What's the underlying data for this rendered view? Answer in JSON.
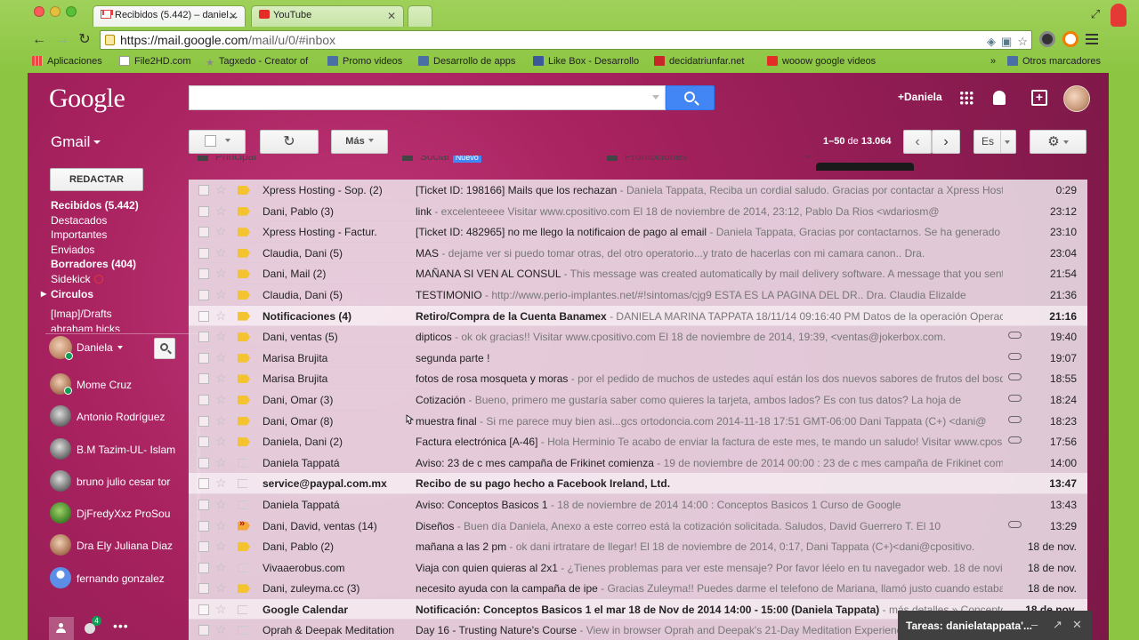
{
  "browser": {
    "tabs": [
      {
        "label": "Recibidos (5.442) – daniel…"
      },
      {
        "label": "YouTube"
      }
    ],
    "url_host": "https://mail.google.com",
    "url_path": "/mail/u/0/#inbox",
    "bookmarks": [
      {
        "label": "Aplicaciones",
        "icon": "apps-icon"
      },
      {
        "label": "File2HD.com",
        "icon": "page-icon"
      },
      {
        "label": "Tagxedo - Creator of",
        "icon": "star-icon"
      },
      {
        "label": "Promo videos",
        "icon": "folder-icon"
      },
      {
        "label": "Desarrollo de apps",
        "icon": "folder-icon"
      },
      {
        "label": "Like Box - Desarrollo",
        "icon": "facebook-icon"
      },
      {
        "label": "decidatriunfar.net",
        "icon": "site-icon"
      },
      {
        "label": "wooow google videos",
        "icon": "youtube-icon"
      },
      {
        "label": "»",
        "icon": ""
      },
      {
        "label": "Otros marcadores",
        "icon": "folder-icon"
      }
    ]
  },
  "gmail": {
    "logo": "Google",
    "search_placeholder": "",
    "account_link": "+Daniela",
    "product_label": "Gmail",
    "more_label": "Más",
    "pager": {
      "range": "1–50",
      "of": "de",
      "total": "13.064"
    },
    "lang": "Es",
    "compose": "REDACTAR",
    "nav": [
      {
        "label": "Recibidos (5.442)",
        "bold": true
      },
      {
        "label": "Destacados",
        "bold": false
      },
      {
        "label": "Importantes",
        "bold": false
      },
      {
        "label": "Enviados",
        "bold": false
      },
      {
        "label": "Borradores (404)",
        "bold": true
      },
      {
        "label": "Sidekick",
        "bold": false
      },
      {
        "label": "Circulos",
        "bold": true
      },
      {
        "label": "[Imap]/Drafts",
        "bold": false
      },
      {
        "label": "abraham hicks",
        "bold": false
      }
    ],
    "chat_user": "Daniela",
    "contacts": [
      {
        "name": "Mome Cruz"
      },
      {
        "name": "Antonio Rodríguez"
      },
      {
        "name": "B.M Tazim-UL- Islam"
      },
      {
        "name": "bruno julio cesar tor"
      },
      {
        "name": "DjFredyXxz ProSou"
      },
      {
        "name": "Dra Ely Juliana Diaz"
      },
      {
        "name": "fernando gonzalez"
      }
    ],
    "hangout_badge": "4",
    "category_tabs": [
      {
        "label": "Principal"
      },
      {
        "label": "Social",
        "badge": "Nuevo"
      },
      {
        "label": "Promociones"
      }
    ],
    "colors": {
      "theme_bg": "#a8225f",
      "accent_blue": "#4285f4",
      "important_yellow": "#f4c430"
    },
    "emails": [
      {
        "sender": "Xpress Hosting - Sop. (2)",
        "subject": "[Ticket ID: 198166] Mails que los rechazan",
        "snippet": " - Daniela Tappata, Reciba un cordial saludo. Gracias por contactar a Xpress Hosting",
        "date": "0:29",
        "unread": false,
        "imp": "on",
        "clip": false
      },
      {
        "sender": "Dani, Pablo (3)",
        "subject": "link",
        "snippet": " - excelenteeee Visitar www.cpositivo.com El 18 de noviembre de 2014, 23:12, Pablo Da Rios <wdariosm@",
        "date": "23:12",
        "unread": false,
        "imp": "on",
        "clip": false
      },
      {
        "sender": "Xpress Hosting - Factur.",
        "subject": "[Ticket ID: 482965] no me llego la notificaion de pago al email",
        "snippet": " - Daniela Tappata, Gracias por contactarnos. Se ha generado el r",
        "date": "23:10",
        "unread": false,
        "imp": "on",
        "clip": false
      },
      {
        "sender": "Claudia, Dani (5)",
        "subject": "MAS",
        "snippet": " - dejame ver si puedo tomar otras, del otro operatorio...y trato de hacerlas con mi camara canon.. Dra.",
        "date": "23:04",
        "unread": false,
        "imp": "on",
        "clip": false
      },
      {
        "sender": "Dani, Mail (2)",
        "subject": "MAÑANA SI VEN AL CONSUL",
        "snippet": " - This message was created automatically by mail delivery software. A message that you sent co",
        "date": "21:54",
        "unread": false,
        "imp": "on",
        "clip": false
      },
      {
        "sender": "Claudia, Dani (5)",
        "subject": "TESTIMONIO",
        "snippet": " - http://www.perio-implantes.net/#!sintomas/cjg9 ESTA ES LA PAGINA DEL DR.. Dra. Claudia Elizalde",
        "date": "21:36",
        "unread": false,
        "imp": "on",
        "clip": false
      },
      {
        "sender": "Notificaciones (4)",
        "subject": "Retiro/Compra de la Cuenta Banamex",
        "snippet": " - DANIELA MARINA TAPPATA 18/11/14 09:16:40 PM Datos de la operación Operació",
        "date": "21:16",
        "unread": true,
        "imp": "on",
        "clip": false
      },
      {
        "sender": "Dani, ventas (5)",
        "subject": "dipticos",
        "snippet": " - ok ok gracias!! Visitar www.cpositivo.com El 18 de noviembre de 2014, 19:39, <ventas@jokerbox.com.",
        "date": "19:40",
        "unread": false,
        "imp": "on",
        "clip": true
      },
      {
        "sender": "Marisa Brujita",
        "subject": "segunda parte !",
        "snippet": "",
        "date": "19:07",
        "unread": false,
        "imp": "on",
        "clip": true
      },
      {
        "sender": "Marisa Brujita",
        "subject": "fotos de rosa mosqueta y moras",
        "snippet": " - por el pedido de muchos de ustedes aquí están los dos nuevos sabores de frutos del bosque,",
        "date": "18:55",
        "unread": false,
        "imp": "on",
        "clip": true
      },
      {
        "sender": "Dani, Omar (3)",
        "subject": "Cotización",
        "snippet": " - Bueno, primero me gustaría saber como quieres la tarjeta, ambos lados? Es con tus datos? La hoja de",
        "date": "18:24",
        "unread": false,
        "imp": "on",
        "clip": true
      },
      {
        "sender": "Dani, Omar (8)",
        "subject": "muestra final",
        "snippet": " - Si me parece muy bien asi...gcs ortodoncia.com 2014-11-18 17:51 GMT-06:00 Dani Tappata (C+) <dani@",
        "date": "18:23",
        "unread": false,
        "imp": "on",
        "clip": true
      },
      {
        "sender": "Daniela, Dani (2)",
        "subject": "Factura electrónica [A-46]",
        "snippet": " - Hola Herminio Te acabo de enviar la factura de este mes, te mando un saludo! Visitar www.cpositivo",
        "date": "17:56",
        "unread": false,
        "imp": "on",
        "clip": true
      },
      {
        "sender": "Daniela Tappatá",
        "subject": "Aviso: 23 de c mes campaña de Frikinet comienza",
        "snippet": " - 19 de noviembre de 2014 00:00 : 23 de c mes campaña de Frikinet comien",
        "date": "14:00",
        "unread": false,
        "imp": "off",
        "clip": false
      },
      {
        "sender": "service@paypal.com.mx",
        "subject": "Recibo de su pago hecho a Facebook Ireland, Ltd.",
        "snippet": "",
        "date": "13:47",
        "unread": true,
        "imp": "off",
        "clip": false
      },
      {
        "sender": "Daniela Tappatá",
        "subject": "Aviso: Conceptos Basicos 1",
        "snippet": " - 18 de noviembre de 2014 14:00 : Conceptos Basicos 1 Curso de Google",
        "date": "13:43",
        "unread": false,
        "imp": "off",
        "clip": false
      },
      {
        "sender": "Dani, David, ventas (14)",
        "subject": "Diseños",
        "snippet": " - Buen día Daniela, Anexo a este correo está la cotización solicitada. Saludos, David Guerrero T. El 10",
        "date": "13:29",
        "unread": false,
        "imp": "fwd",
        "clip": true
      },
      {
        "sender": "Dani, Pablo (2)",
        "subject": "mañana a las 2 pm",
        "snippet": " - ok dani irtratare de llegar! El 18 de noviembre de 2014, 0:17, Dani Tappata (C+)<dani@cpositivo.",
        "date": "18 de nov.",
        "unread": false,
        "imp": "on",
        "clip": false
      },
      {
        "sender": "Vivaaerobus.com",
        "subject": "Viaja con quien quieras al 2x1",
        "snippet": " - ¿Tienes problemas para ver este mensaje? Por favor léelo en tu navegador web. 18 de noviem",
        "date": "18 de nov.",
        "unread": false,
        "imp": "off",
        "clip": false
      },
      {
        "sender": "Dani, zuleyma.cc (3)",
        "subject": "necesito ayuda con la campaña de ipe",
        "snippet": " - Gracias Zuleyma!! Puedes darme el telefono de Mariana, llamó justo cuando estaba en",
        "date": "18 de nov.",
        "unread": false,
        "imp": "on",
        "clip": false
      },
      {
        "sender": "Google Calendar",
        "subject": "Notificación: Conceptos Basicos 1 el mar 18 de Nov de 2014 14:00 - 15:00 (Daniela Tappata)",
        "snippet": " - más detalles » Conceptos B",
        "date": "18 de nov.",
        "unread": true,
        "imp": "off",
        "clip": false
      },
      {
        "sender": "Oprah & Deepak Meditation",
        "subject": "Day 16 - Trusting Nature's Course",
        "snippet": " - View in browser Oprah and Deepak's 21-Day Meditation Experience",
        "date": "18 de nov.",
        "unread": false,
        "imp": "off",
        "clip": false
      }
    ],
    "tasks_title": "Tareas: danielatappata'..."
  }
}
